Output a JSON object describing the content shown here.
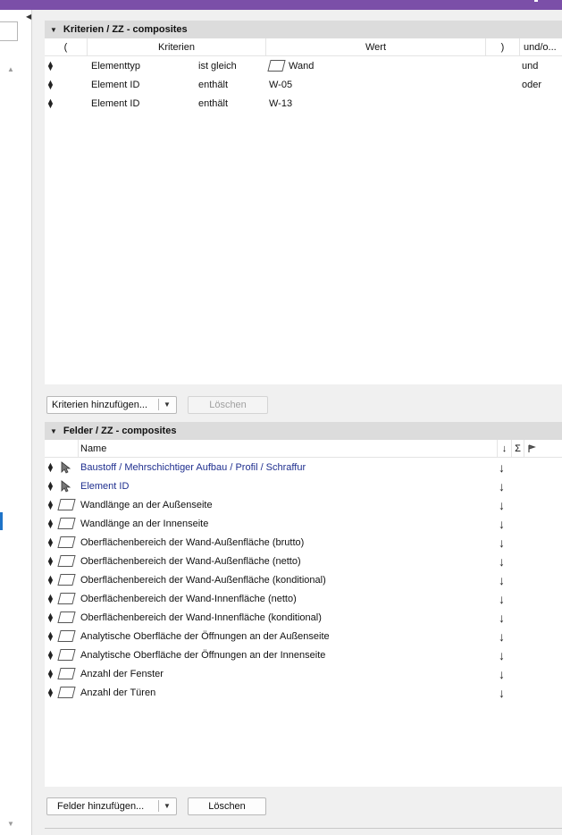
{
  "criteria_panel": {
    "title": "Kriterien / ZZ  - composites",
    "columns": {
      "open_paren": "(",
      "criteria": "Kriterien",
      "value": "Wert",
      "close_paren": ")",
      "and_or": "und/o..."
    },
    "rows": [
      {
        "criterion": "Elementtyp",
        "operator": "ist gleich",
        "value": "Wand",
        "value_icon": "wall-icon",
        "and_or": "und"
      },
      {
        "criterion": "Element ID",
        "operator": "enthält",
        "value": "W-05",
        "and_or": "oder"
      },
      {
        "criterion": "Element ID",
        "operator": "enthält",
        "value": "W-13",
        "and_or": ""
      }
    ],
    "add_button": "Kriterien hinzufügen...",
    "delete_button": "Löschen"
  },
  "fields_panel": {
    "title": "Felder / ZZ  - composites",
    "columns": {
      "name": "Name",
      "sort": "↓",
      "sum": "Σ",
      "flag": "flag-icon"
    },
    "rows": [
      {
        "icon": "cursor-icon",
        "name": "Baustoff / Mehrschichtiger Aufbau / Profil / Schraffur",
        "link": true
      },
      {
        "icon": "cursor-icon",
        "name": "Element ID",
        "link": true
      },
      {
        "icon": "wall-icon",
        "name": "Wandlänge an der Außenseite"
      },
      {
        "icon": "wall-icon",
        "name": "Wandlänge an der Innenseite"
      },
      {
        "icon": "wall-icon",
        "name": "Oberflächenbereich der Wand-Außenfläche (brutto)"
      },
      {
        "icon": "wall-icon",
        "name": "Oberflächenbereich der Wand-Außenfläche (netto)"
      },
      {
        "icon": "wall-icon",
        "name": "Oberflächenbereich der Wand-Außenfläche (konditional)"
      },
      {
        "icon": "wall-icon",
        "name": "Oberflächenbereich der Wand-Innenfläche (netto)"
      },
      {
        "icon": "wall-icon",
        "name": "Oberflächenbereich der Wand-Innenfläche (konditional)"
      },
      {
        "icon": "wall-icon",
        "name": "Analytische Oberfläche der Öffnungen an der Außenseite"
      },
      {
        "icon": "wall-icon",
        "name": "Analytische Oberfläche der Öffnungen an der Innenseite"
      },
      {
        "icon": "wall-icon",
        "name": "Anzahl der Fenster"
      },
      {
        "icon": "wall-icon",
        "name": "Anzahl der Türen"
      }
    ],
    "sort_symbol": "↓",
    "add_button": "Felder hinzufügen...",
    "delete_button": "Löschen"
  },
  "colors": {
    "titlebar": "#7b4fa8",
    "link": "#1f2f8f",
    "selection": "#1e73c8"
  }
}
